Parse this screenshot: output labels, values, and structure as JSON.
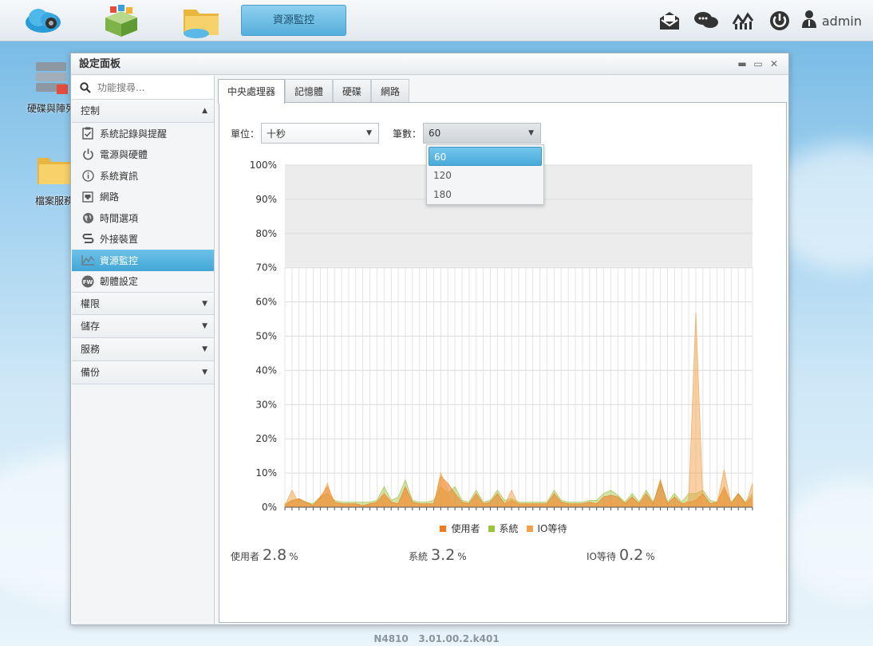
{
  "topbar": {
    "active_tab": "資源監控",
    "user": "admin"
  },
  "desktop": {
    "icons": [
      {
        "label": "硬碟與陣列"
      },
      {
        "label": "檔案服務"
      }
    ]
  },
  "window": {
    "title": "設定面板"
  },
  "sidebar": {
    "search_placeholder": "功能搜尋...",
    "control_section": "控制",
    "items": [
      {
        "label": "系統記錄與提醒",
        "icon": "clipboard-check-icon"
      },
      {
        "label": "電源與硬體",
        "icon": "power-icon"
      },
      {
        "label": "系統資訊",
        "icon": "info-icon"
      },
      {
        "label": "網路",
        "icon": "network-port-icon"
      },
      {
        "label": "時間選項",
        "icon": "globe-icon"
      },
      {
        "label": "外接裝置",
        "icon": "usb-icon"
      },
      {
        "label": "資源監控",
        "icon": "chart-icon"
      },
      {
        "label": "韌體設定",
        "icon": "fw-icon"
      }
    ],
    "sections": [
      {
        "label": "權限"
      },
      {
        "label": "儲存"
      },
      {
        "label": "服務"
      },
      {
        "label": "備份"
      }
    ]
  },
  "tabs": [
    {
      "label": "中央處理器"
    },
    {
      "label": "記憶體"
    },
    {
      "label": "硬碟"
    },
    {
      "label": "網路"
    }
  ],
  "controls": {
    "unit_label": "單位：",
    "unit_value": "十秒",
    "count_label": "筆數：",
    "count_value": "60",
    "count_options": [
      "60",
      "120",
      "180"
    ]
  },
  "chart_data": {
    "type": "area",
    "ylim": [
      0,
      100
    ],
    "y_ticks": [
      "0%",
      "10%",
      "20%",
      "30%",
      "40%",
      "50%",
      "60%",
      "70%",
      "80%",
      "90%",
      "100%"
    ],
    "colors": {
      "user": "#f07a1c",
      "system": "#9dc23c",
      "iowait": "#f4a24a"
    },
    "series": [
      {
        "name": "使用者",
        "values": [
          0.5,
          2,
          2.5,
          1.5,
          0.5,
          3,
          6,
          1.5,
          1,
          1,
          1,
          0.5,
          1,
          1.5,
          4,
          1.5,
          1,
          6,
          1.5,
          1,
          1,
          1,
          9,
          7,
          4,
          1.5,
          1,
          4,
          1,
          1.5,
          4,
          1,
          2,
          1,
          1,
          1,
          1,
          1,
          4,
          1.5,
          1,
          1,
          1,
          1.5,
          1,
          3,
          3.5,
          3,
          1,
          3,
          1,
          4,
          1,
          8,
          1,
          3,
          1,
          1.5,
          2,
          4,
          1,
          1.5,
          6,
          1,
          4,
          1,
          3
        ]
      },
      {
        "name": "系統",
        "values": [
          1,
          2,
          2.5,
          1.5,
          1,
          3,
          4,
          2,
          1.5,
          1.5,
          1.5,
          1.5,
          1.5,
          2,
          6,
          2,
          3,
          8,
          2,
          1.5,
          1.5,
          2,
          6,
          4,
          6,
          2,
          1.5,
          5,
          1.5,
          2,
          5,
          2,
          2.5,
          1.5,
          1.5,
          1.5,
          1.5,
          1.5,
          5,
          2,
          1.5,
          1.5,
          1.5,
          2,
          2,
          4,
          5,
          3.5,
          1.5,
          4,
          1.5,
          5,
          1.5,
          7,
          1.5,
          4,
          1.5,
          4,
          4,
          5,
          2,
          1.5,
          5,
          1.5,
          4,
          1.5,
          4
        ]
      },
      {
        "name": "IO等待",
        "values": [
          0.5,
          5,
          1,
          0.5,
          0.5,
          2,
          7,
          0.5,
          0.5,
          0.5,
          0.5,
          0.5,
          0.5,
          0.5,
          4,
          0.5,
          0.5,
          5,
          0.5,
          0.5,
          0.5,
          0.5,
          10,
          5,
          1,
          0.5,
          0.5,
          2,
          0.5,
          0.5,
          1,
          0.5,
          5,
          0.5,
          0.5,
          0.5,
          0.5,
          0.5,
          2,
          0.5,
          0.5,
          0.5,
          0.5,
          0.5,
          0.5,
          1,
          2,
          1,
          0.5,
          2,
          0.5,
          2,
          0.5,
          3,
          0.5,
          1,
          0.5,
          2,
          57,
          2,
          0.5,
          1,
          11,
          0.5,
          3,
          0.5,
          7
        ]
      }
    ]
  },
  "legend": [
    {
      "label": "使用者",
      "color": "#f07a1c"
    },
    {
      "label": "系統",
      "color": "#9dc23c"
    },
    {
      "label": "IO等待",
      "color": "#f4a24a"
    }
  ],
  "stats": {
    "user_label": "使用者",
    "user_value": "2.8",
    "user_unit": "%",
    "system_label": "系統",
    "system_value": "3.2",
    "system_unit": "%",
    "iowait_label": "IO等待",
    "iowait_value": "0.2",
    "iowait_unit": "%"
  },
  "footer": {
    "model": "N4810",
    "version": "3.01.00.2.k401"
  }
}
